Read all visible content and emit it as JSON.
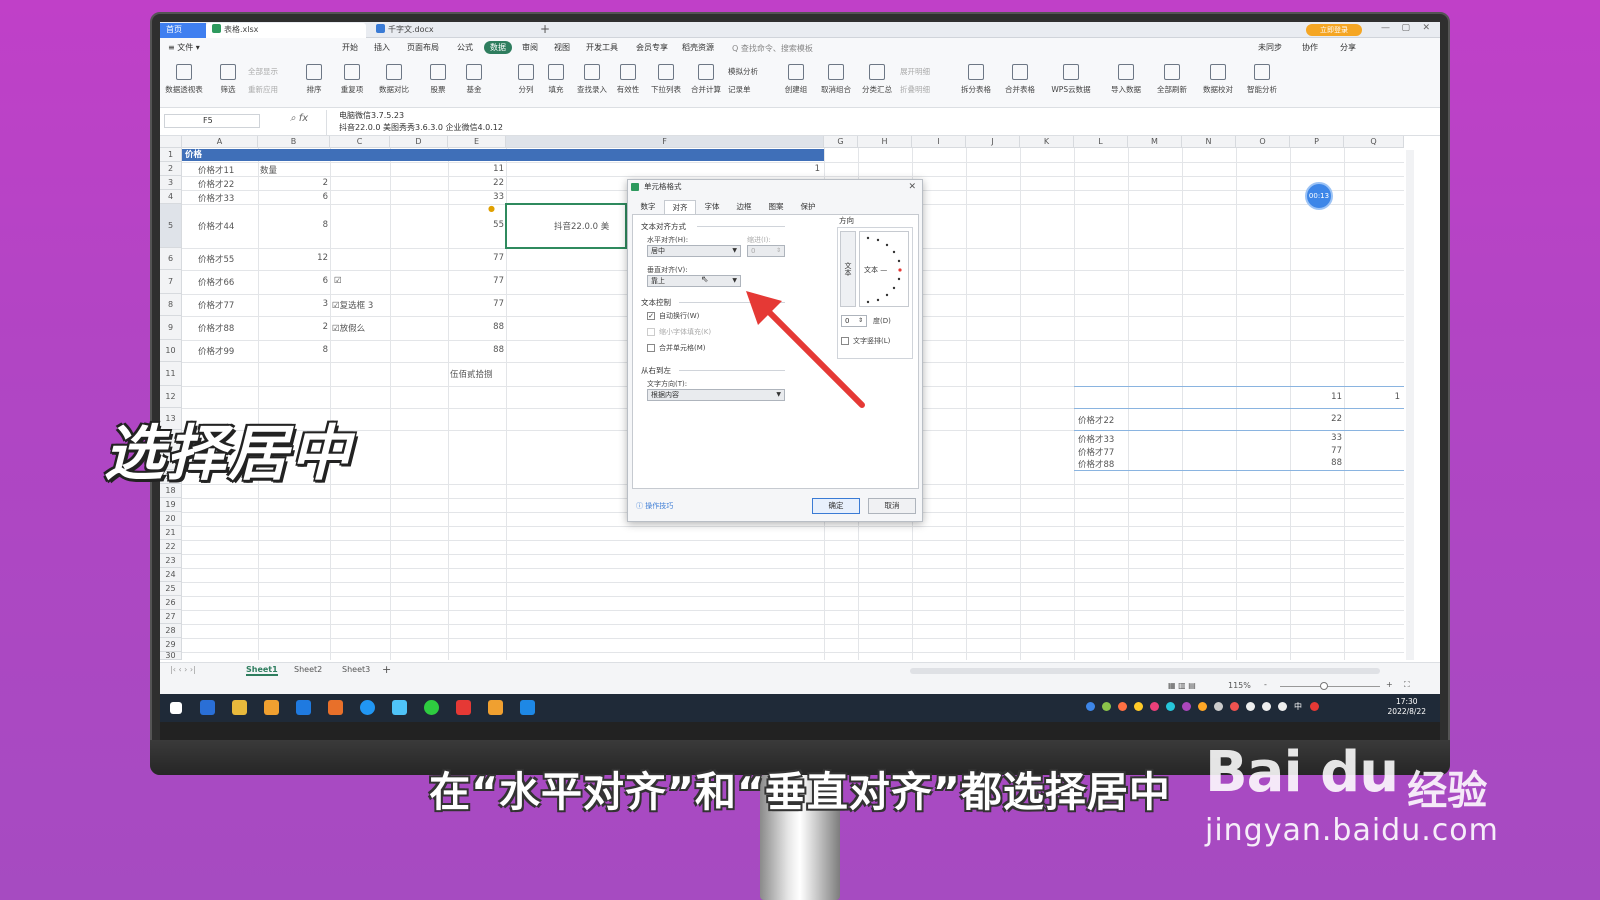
{
  "colors": {
    "accent_green": "#2e7d5e",
    "header_blue": "#3f6fb8",
    "arrow_red": "#e53935",
    "background": "#b145c4"
  },
  "titlebar": {
    "home_tab": "首页",
    "file_tab_1": "表格.xlsx",
    "file_tab_2": "千字文.docx",
    "login_button": "立即登录",
    "add_tab_icon": "plus-icon"
  },
  "menubar": {
    "file_menu": "≡ 文件 ▾",
    "items": [
      "开始",
      "插入",
      "页面布局",
      "公式",
      "数据",
      "审阅",
      "视图",
      "开发工具",
      "会员专享",
      "稻壳资源"
    ],
    "active_item": "数据",
    "search": "Q 查找命令、搜索模板",
    "sync": "未同步",
    "collab": "协作",
    "share": "分享"
  },
  "ribbon": {
    "buttons": [
      "数据透视表",
      "筛选",
      "排序",
      "重复项",
      "数据对比",
      "股票",
      "基金",
      "分列",
      "填充",
      "查找录入",
      "有效性",
      "下拉列表",
      "合并计算",
      "创建组",
      "取消组合",
      "分类汇总",
      "拆分表格",
      "合并表格",
      "WPS云数据",
      "导入数据",
      "全部刷新",
      "数据校对",
      "智能分析"
    ],
    "small_buttons": [
      "全部显示",
      "重新应用",
      "模拟分析",
      "记录单",
      "展开明细",
      "折叠明细"
    ]
  },
  "formula_bar": {
    "cell_ref": "F5",
    "fx_label": "fx",
    "line1": "电脑微信3.7.5.23",
    "line2": "抖音22.0.0 美图秀秀3.6.3.0 企业微信4.0.12"
  },
  "grid": {
    "columns": [
      "A",
      "B",
      "C",
      "D",
      "E",
      "F",
      "G",
      "H",
      "I",
      "J",
      "K",
      "L",
      "M",
      "N",
      "O",
      "P",
      "Q"
    ],
    "rows": [
      "1",
      "2",
      "3",
      "4",
      "5",
      "6",
      "7",
      "8",
      "9",
      "10",
      "11",
      "12",
      "13",
      "16",
      "17",
      "18",
      "19",
      "20",
      "21",
      "22",
      "23",
      "24",
      "25",
      "26",
      "27",
      "28",
      "29",
      "30"
    ],
    "header_title": "价格",
    "col_a": [
      "价格才11",
      "价格才22",
      "价格才33",
      "价格才44",
      "价格才55",
      "价格才66",
      "价格才77",
      "价格才88",
      "价格才99"
    ],
    "col_b": [
      "数量",
      "2",
      "6",
      "8",
      "12",
      "6",
      "3",
      "2",
      "8"
    ],
    "col_c": [
      "",
      "",
      "",
      "",
      "",
      "☑",
      "☑复选框 3",
      "☑放假么",
      ""
    ],
    "col_e": [
      "11",
      "22",
      "33",
      "55",
      "77",
      "77",
      "77",
      "88",
      "88",
      "伍佰贰拾捌"
    ],
    "f2_value": "1",
    "f5_value": "抖音22.0.0 美",
    "right_table": {
      "p12": "11",
      "q12": "1",
      "rows": [
        [
          "价格才22",
          "22"
        ],
        [
          "价格才33",
          "33"
        ],
        [
          "价格才77",
          "77"
        ],
        [
          "价格才88",
          "88"
        ]
      ]
    }
  },
  "timer": "00:13",
  "sheets": {
    "tabs": [
      "Sheet1",
      "Sheet2",
      "Sheet3"
    ],
    "active": "Sheet1",
    "add_icon": "+"
  },
  "status": {
    "zoom": "115%",
    "zoom_minus": "-",
    "zoom_plus": "+"
  },
  "taskbar": {
    "time": "17:30",
    "date": "2022/8/22",
    "lang": "中"
  },
  "dialog": {
    "title": "单元格格式",
    "tabs": [
      "数字",
      "对齐",
      "字体",
      "边框",
      "图案",
      "保护"
    ],
    "active_tab": "对齐",
    "text_align_group": "文本对齐方式",
    "horizontal_label": "水平对齐(H):",
    "horizontal_value": "居中",
    "indent_label": "缩进(I):",
    "indent_value": "0",
    "vertical_label": "垂直对齐(V):",
    "vertical_value": "靠上",
    "text_control_group": "文本控制",
    "wrap_text": "自动换行(W)",
    "shrink_fit": "缩小字体填充(K)",
    "merge_cells": "合并单元格(M)",
    "rtl_group": "从右到左",
    "text_direction_label": "文字方向(T):",
    "text_direction_value": "根据内容",
    "orientation_group": "方向",
    "orientation_vertical_text": "文本",
    "orientation_text": "文本 —",
    "degree_value": "0",
    "degree_label": "度(D)",
    "vertical_text_option": "文字竖排(L)",
    "tips": "操作技巧",
    "ok": "确定",
    "cancel": "取消"
  },
  "overlay": {
    "hint": "选择居中",
    "subtitle": "在“水平对齐”和“垂直对齐”都选择居中"
  },
  "watermark": {
    "logo": "Bai du",
    "brand": "经验",
    "url": "jingyan.baidu.com"
  }
}
